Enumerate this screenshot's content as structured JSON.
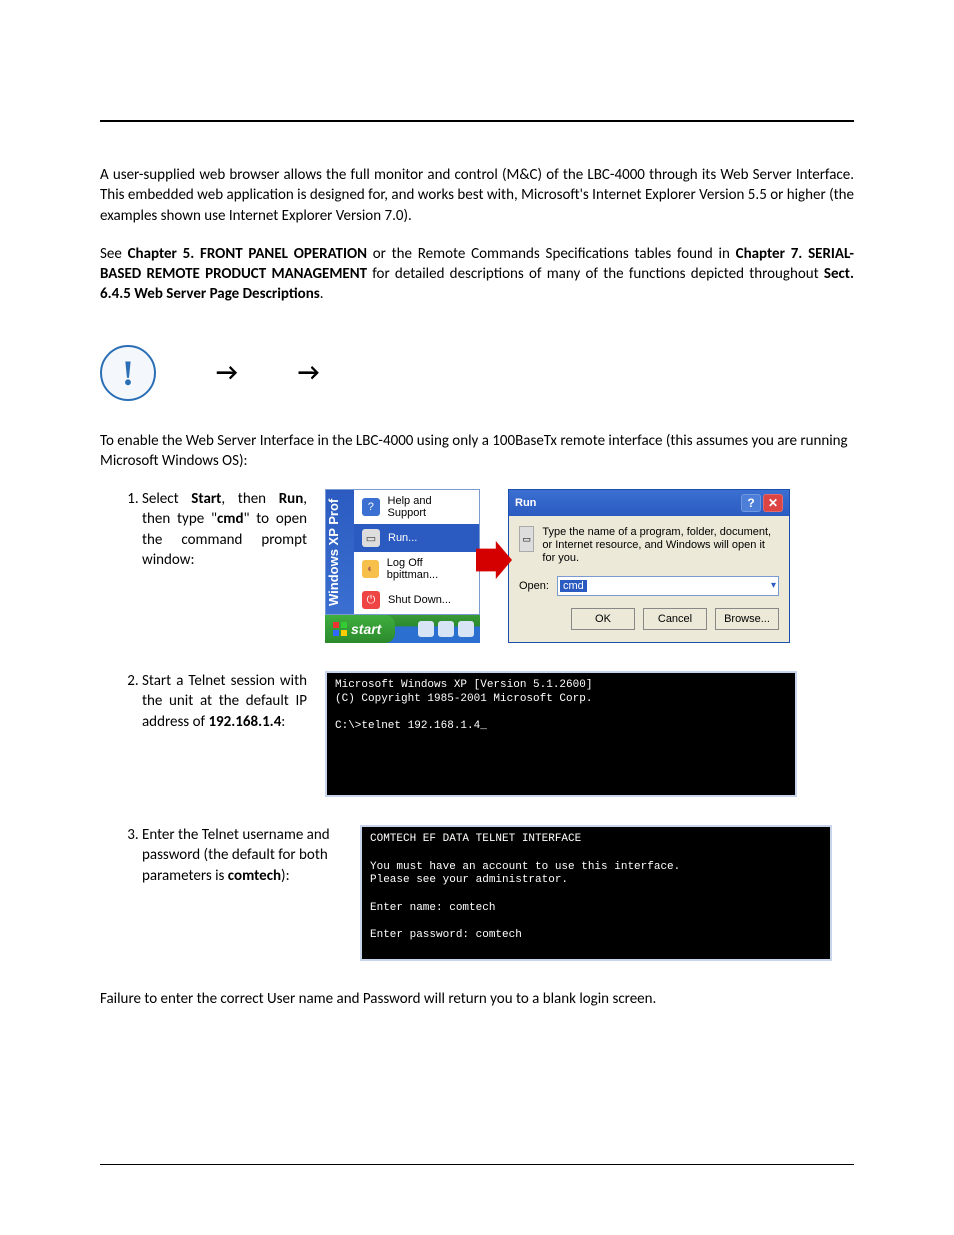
{
  "paragraphs": {
    "p1": "A user-supplied web browser allows the full monitor and control (M&C) of the LBC-4000 through its Web Server Interface. This embedded web application is designed for, and works best with, Microsoft's Internet Explorer Version 5.5 or higher (the examples shown use Internet Explorer Version 7.0).",
    "p2_pre": "See ",
    "p2_b1": "Chapter 5. FRONT PANEL OPERATION",
    "p2_mid1": " or the Remote Commands Specifications tables found in ",
    "p2_b2": "Chapter 7. SERIAL-BASED REMOTE PRODUCT MANAGEMENT",
    "p2_mid2": " for detailed descriptions of many of the functions depicted throughout ",
    "p2_b3": "Sect. 6.4.5 Web Server Page Descriptions",
    "p2_end": ".",
    "p3": "To enable the Web Server Interface in the LBC-4000 using only a 100BaseTx remote interface (this assumes you are running Microsoft Windows OS):",
    "failure": "Failure to enter the correct User name and Password will return you to a blank login screen."
  },
  "notice": {
    "arrow1": "→",
    "arrow2": "→"
  },
  "steps": {
    "s1_pre": "Select ",
    "s1_b1": "Start",
    "s1_mid1": ", then ",
    "s1_b2": "Run",
    "s1_mid2": ", then type \"",
    "s1_b3": "cmd",
    "s1_end": "\" to open the command prompt window:",
    "s2_pre": "Start a Telnet session with the unit at the default IP address of ",
    "s2_b1": "192.168.1.4",
    "s2_end": ":",
    "s3_pre": "Enter the Telnet username and password (the default for both parameters is ",
    "s3_b1": "comtech",
    "s3_end": "):"
  },
  "xp": {
    "sidebar": "Windows XP Prof",
    "help": "Help and Support",
    "run": "Run...",
    "logoff": "Log Off bpittman...",
    "shutdown": "Shut Down...",
    "start": "start"
  },
  "run_dialog": {
    "title": "Run",
    "desc": "Type the name of a program, folder, document, or Internet resource, and Windows will open it for you.",
    "open_label": "Open:",
    "value": "cmd",
    "ok": "OK",
    "cancel": "Cancel",
    "browse": "Browse..."
  },
  "terminal1": "Microsoft Windows XP [Version 5.1.2600]\n(C) Copyright 1985-2001 Microsoft Corp.\n\nC:\\>telnet 192.168.1.4_",
  "terminal2": "COMTECH EF DATA TELNET INTERFACE\n\nYou must have an account to use this interface.\nPlease see your administrator.\n\nEnter name: comtech\n\nEnter password: comtech"
}
